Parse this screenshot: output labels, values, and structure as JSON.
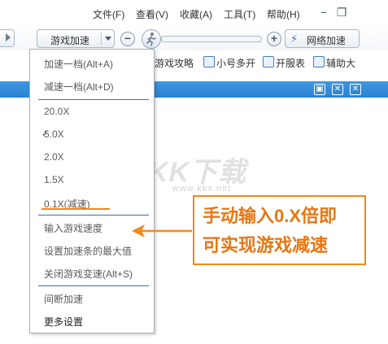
{
  "menubar": {
    "items": [
      "文件(F)",
      "查看(V)",
      "收藏(A)",
      "工具(T)",
      "帮助(H)"
    ],
    "minimize": "−",
    "maximize": "❐"
  },
  "toolbar": {
    "speed_select": "游戏加速",
    "minus": "−",
    "plus": "+",
    "network_accel": "网络加速"
  },
  "toolbar2": {
    "items": [
      "游戏攻略",
      "小号多开",
      "开服表",
      "辅助大"
    ]
  },
  "window_strip": {
    "buttons": [
      "▣",
      "✕",
      "✕"
    ]
  },
  "dropdown": {
    "items": [
      "加速一档(Alt+A)",
      "减速一档(Alt+D)",
      "20.0X",
      "5.0X",
      "2.0X",
      "1.5X",
      "0.1X(减速)",
      "输入游戏速度",
      "设置加速条的最大值",
      "关闭游戏变速(Alt+S)",
      "间断加速",
      "更多设置"
    ],
    "checked_item": "5.0X",
    "check_mark": "✓"
  },
  "watermark": {
    "text": "KK下载",
    "url": "www.kkx.net"
  },
  "annotation": {
    "line1": "手动输入0.X倍即",
    "line2": "可实现游戏减速",
    "color": "#f08a1c"
  }
}
